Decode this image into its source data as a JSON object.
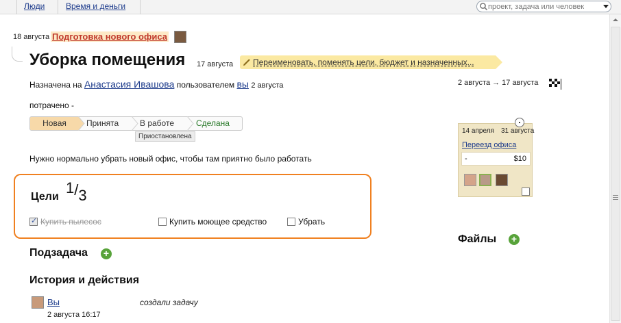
{
  "topbar": {
    "nav": [
      "Люди",
      "Время и деньги"
    ],
    "search_placeholder": "проект, задача или человек"
  },
  "parent": {
    "date": "18 августа",
    "title": "Подготовка нового офиса"
  },
  "task": {
    "title": "Уборка помещения",
    "date": "17 августа",
    "rename_label": "Переименовать, поменять цели, бюджет и назначенных..."
  },
  "assigned": {
    "prefix": "Назначена на",
    "assignee": "Анастасия Ивашова",
    "by_text": "пользователем",
    "by_user": "вы",
    "date": "2 августа"
  },
  "schedule": {
    "range": "2 августа → 17 августа"
  },
  "spent": "потрачено -",
  "statuses": {
    "new": "Новая",
    "accepted": "Принята",
    "in_work": "В работе",
    "done": "Сделана",
    "paused": "Приостановлена",
    "current": "Новая"
  },
  "description": "Нужно нормально убрать новый офис, чтобы там приятно было работать",
  "goals": {
    "title": "Цели",
    "done_count": "1",
    "total_count": "3",
    "items": [
      {
        "label": "Купить пылесос",
        "checked": true
      },
      {
        "label": "Купить моющее средство",
        "checked": false
      },
      {
        "label": "Убрать",
        "checked": false
      }
    ]
  },
  "subtask_title": "Подзадача",
  "history": {
    "title": "История и действия",
    "entries": [
      {
        "user": "Вы",
        "action": "создали задачу",
        "time": "2 августа 16:17"
      }
    ]
  },
  "project_card": {
    "start": "14 апреля",
    "end": "31 августа",
    "name": "Переезд офиса",
    "budget_left": "-",
    "budget_right": "$10"
  },
  "files_title": "Файлы",
  "colors": {
    "link": "#1e3c8c",
    "goals_border": "#f08020",
    "add_green": "#58a33a",
    "rename_bg": "#fbe9a2",
    "card_bg": "#f0e6c6"
  },
  "icons": [
    "search-icon",
    "dropdown-arrow-icon",
    "pencil-icon",
    "finish-flag-icon",
    "clock-icon",
    "plus-icon",
    "checkbox-icon"
  ]
}
